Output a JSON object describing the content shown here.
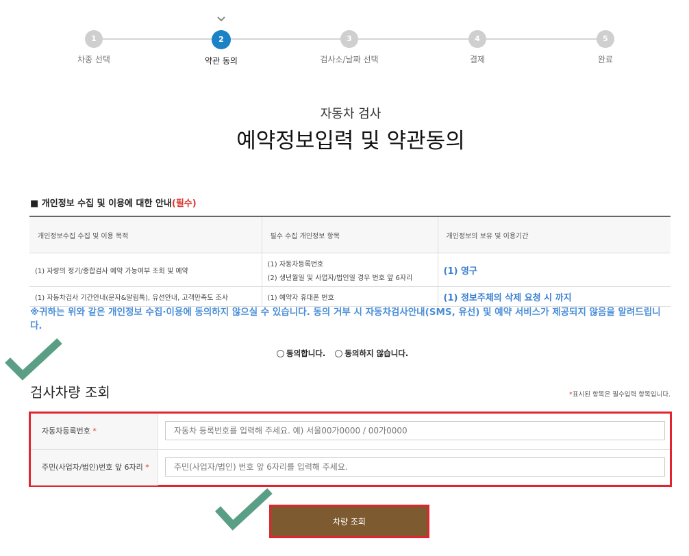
{
  "stepper": {
    "steps": [
      {
        "num": "1",
        "label": "차종 선택"
      },
      {
        "num": "2",
        "label": "약관 동의"
      },
      {
        "num": "3",
        "label": "검사소/날짜 선택"
      },
      {
        "num": "4",
        "label": "결제"
      },
      {
        "num": "5",
        "label": "완료"
      }
    ]
  },
  "heading": {
    "sub": "자동차 검사",
    "main": "예약정보입력 및 약관동의"
  },
  "privacy": {
    "title": "■ 개인정보 수집 및 이용에 대한 안내",
    "required": "(필수)",
    "headers": [
      "개인정보수집 수집 및 이용 목적",
      "필수 수집 개인정보 항목",
      "개인정보의 보유 및 이용기간"
    ],
    "rows": [
      {
        "purpose": "(1) 자량의 정기/종합검사 예약 가능여부 조회 및 예약",
        "items": [
          "(1) 자동차등록번호",
          "(2) 생년월일 및 사업자/법인일 경우 번호 앞 6자리"
        ],
        "period": "(1) 영구"
      },
      {
        "purpose": "(1) 자동차검사 기간안내(문자&알림톡), 유선안내, 고객만족도 조사",
        "items": [
          "(1) 예약자 휴대폰 번호"
        ],
        "period": "(1) 정보주체의 삭제 요청 시 까지"
      }
    ],
    "notice": "※귀하는 위와 같은 개인정보 수집·이용에 동의하지 않으실 수 있습니다. 동의 거부 시 자동차검사안내(SMS, 유선) 및 예약 서비스가 제공되지 않음을 알려드립니다.",
    "agree_label": "동의합니다.",
    "disagree_label": "동의하지 않습니다."
  },
  "vehicle": {
    "title": "검사차량 조회",
    "required_note_star": "*",
    "required_note": "표시된 항목은 필수입력 항목입니다.",
    "fields": [
      {
        "label": "자동차등록번호",
        "placeholder": "자동차 등록번호를 입력해 주세요. 예) 서울00가0000 / 00가0000"
      },
      {
        "label": "주민(사업자/법인)번호 앞 6자리",
        "placeholder": "주민(사업자/법인) 번호 앞 6자리를 입력해 주세요."
      }
    ],
    "search_button": "차량 조회"
  },
  "colors": {
    "accent": "#1a82c5",
    "highlight": "#e0252f",
    "button": "#7d5a30",
    "notice": "#4a8ed8",
    "check": "#5b9e86"
  }
}
